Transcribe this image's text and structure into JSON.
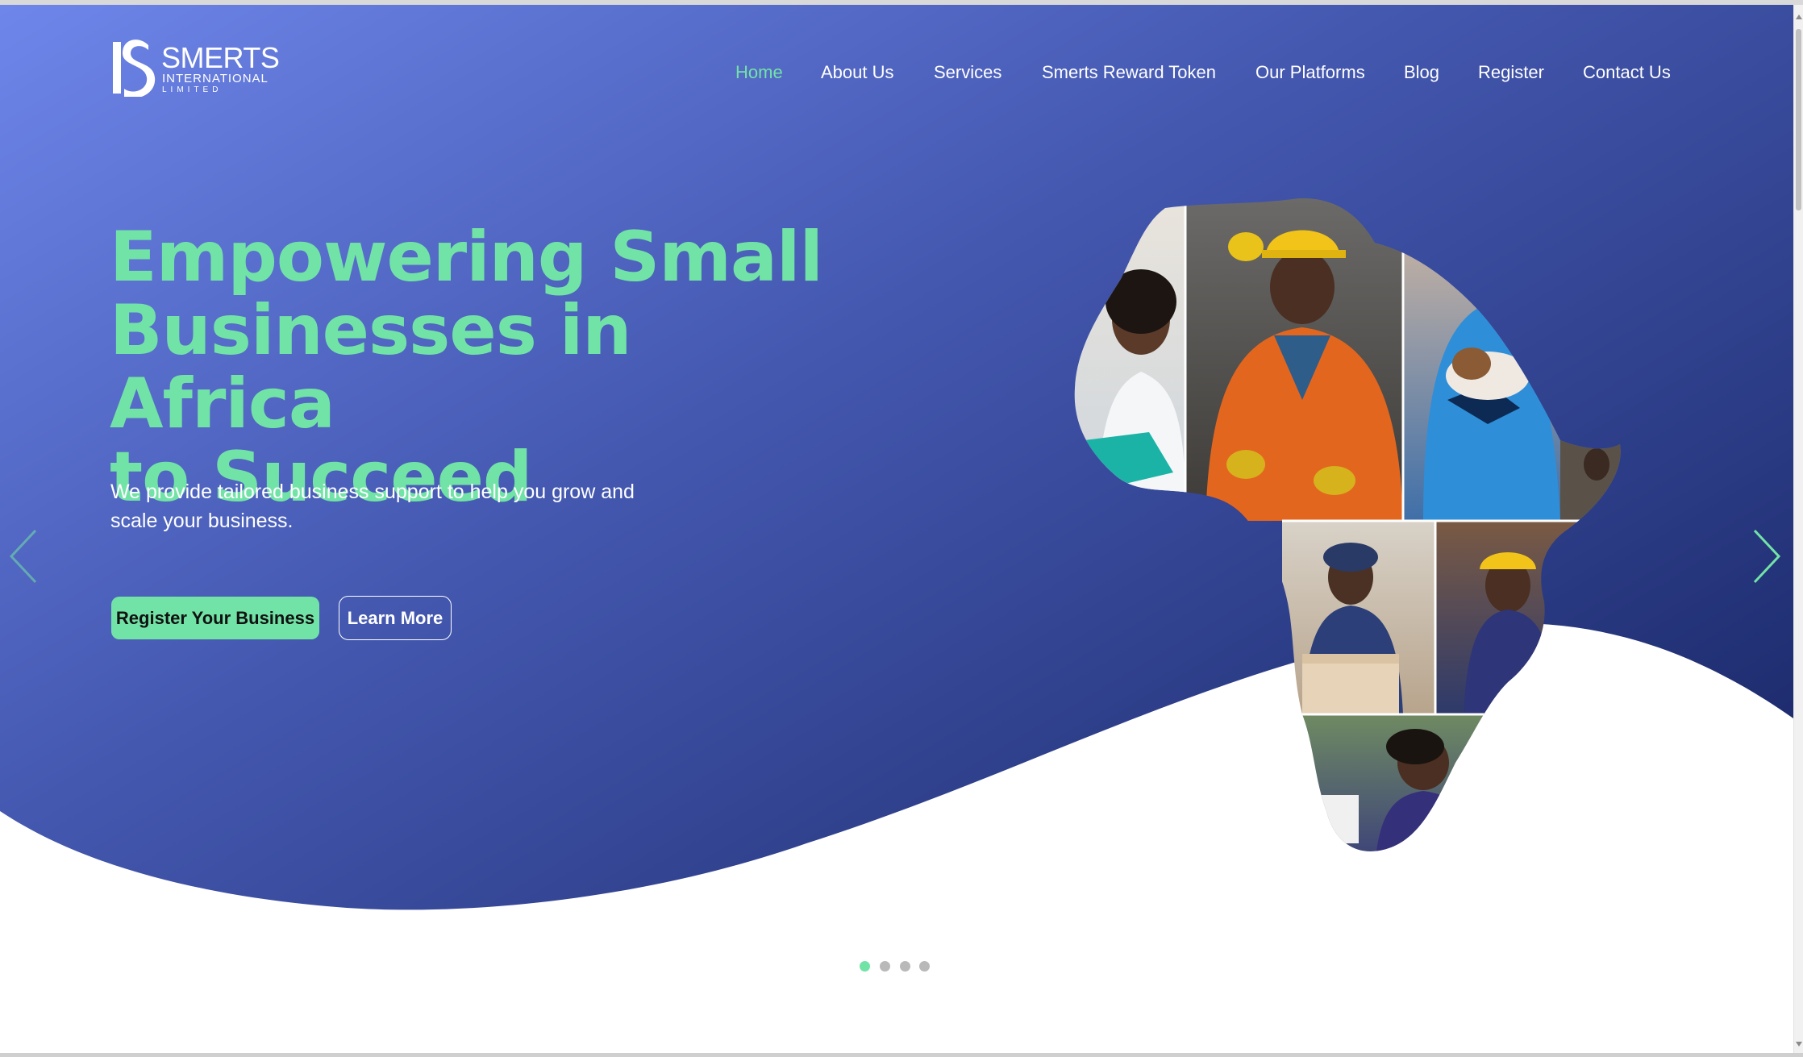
{
  "brand": {
    "name": "SMERTS",
    "line1": "INTERNATIONAL",
    "line2": "LIMITED"
  },
  "nav": {
    "items": [
      {
        "label": "Home",
        "active": true
      },
      {
        "label": "About Us"
      },
      {
        "label": "Services"
      },
      {
        "label": "Smerts Reward Token"
      },
      {
        "label": "Our Platforms"
      },
      {
        "label": "Blog"
      },
      {
        "label": "Register"
      },
      {
        "label": "Contact Us"
      }
    ]
  },
  "hero": {
    "headline_1": "Empowering Small",
    "headline_2": "Businesses in Africa",
    "headline_3": "to Succeed",
    "subtext": "We provide tailored business support to help you grow and scale your business.",
    "primary_cta": "Register Your Business",
    "secondary_cta": "Learn More"
  },
  "carousel": {
    "total_slides": 4,
    "active_slide": 1
  },
  "colors": {
    "accent": "#72e3a6",
    "gradient_start": "#6e86ea",
    "gradient_mid": "#4458b0",
    "gradient_end": "#1c2a6b",
    "text_on_dark": "#ffffff"
  },
  "icons": {
    "prev": "chevron-left-icon",
    "next": "chevron-right-icon",
    "collage": "africa-map-photo-collage"
  }
}
